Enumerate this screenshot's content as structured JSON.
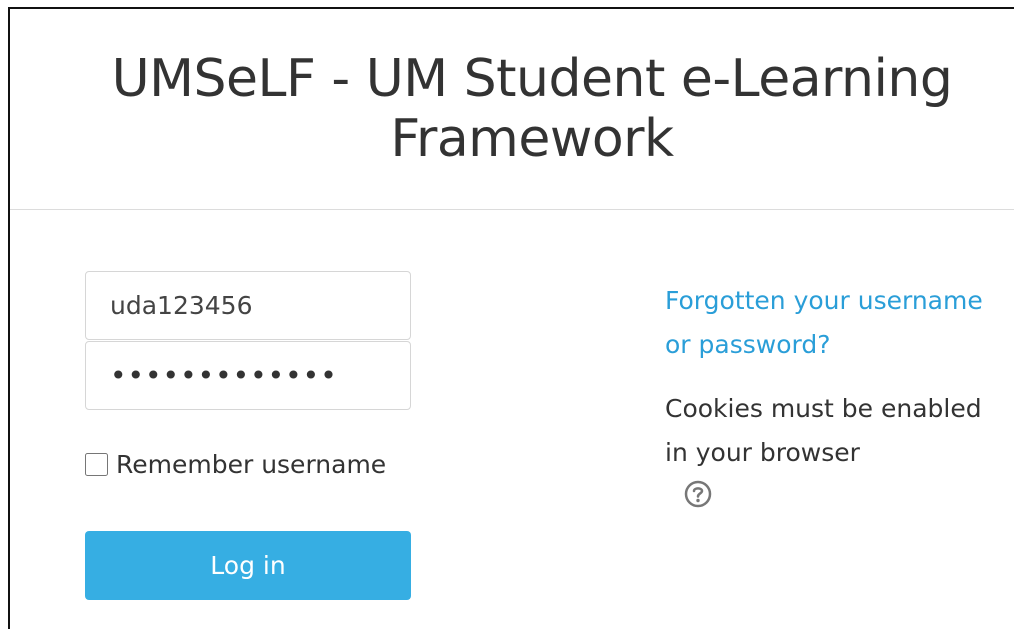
{
  "header": {
    "title": "UMSeLF - UM Student e-Learning Framework"
  },
  "login_form": {
    "username_value": "uda123456",
    "password_value": "•••••••••••••",
    "remember_label": "Remember username",
    "remember_checked": false,
    "login_button_label": "Log in"
  },
  "info": {
    "forgot_link": "Forgotten your username or password?",
    "cookies_text": "Cookies must be enabled in your browser",
    "help_icon": "question-circle-icon"
  },
  "colors": {
    "button": "#36aee3",
    "link": "#2a9ed8",
    "text": "#333333"
  }
}
